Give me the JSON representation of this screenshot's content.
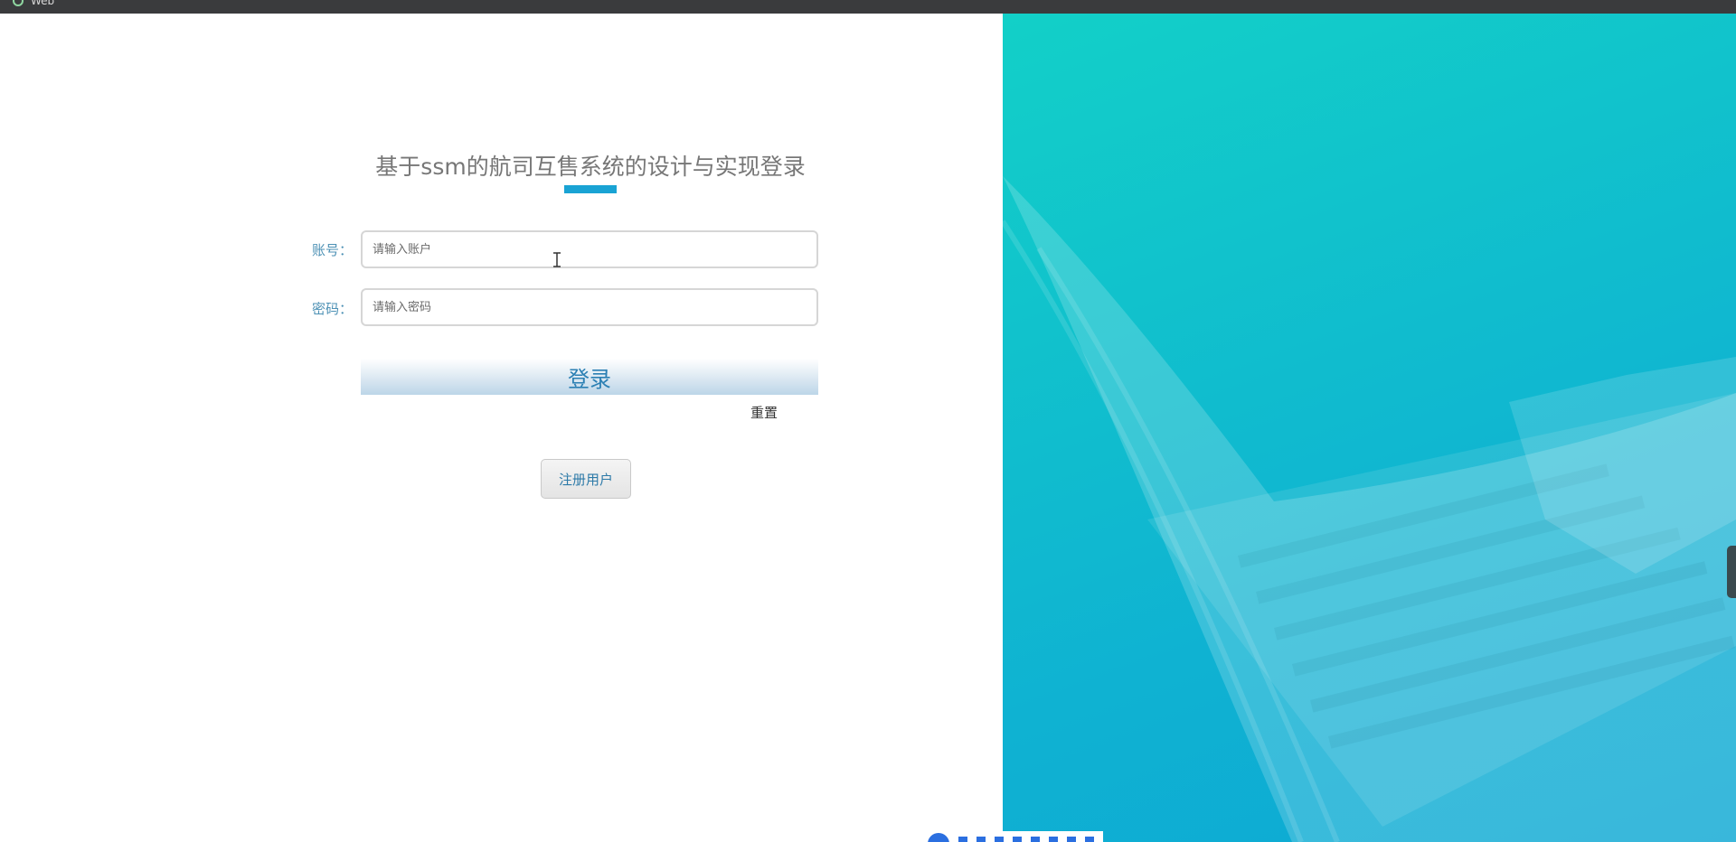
{
  "window": {
    "title": "Web"
  },
  "login": {
    "title": "基于ssm的航司互售系统的设计与实现登录",
    "account_label": "账号：",
    "account_placeholder": "请输入账户",
    "password_label": "密码：",
    "password_placeholder": "请输入密码",
    "login_button": "登录",
    "reset_link": "重置",
    "register_button": "注册用户"
  },
  "colors": {
    "accent": "#19a3d4",
    "label": "#4d91b5",
    "hero_start": "#12d0c8",
    "hero_end": "#0ea8d4"
  },
  "icons": {
    "topbar": "app-icon",
    "cursor": "text-cursor-icon"
  }
}
